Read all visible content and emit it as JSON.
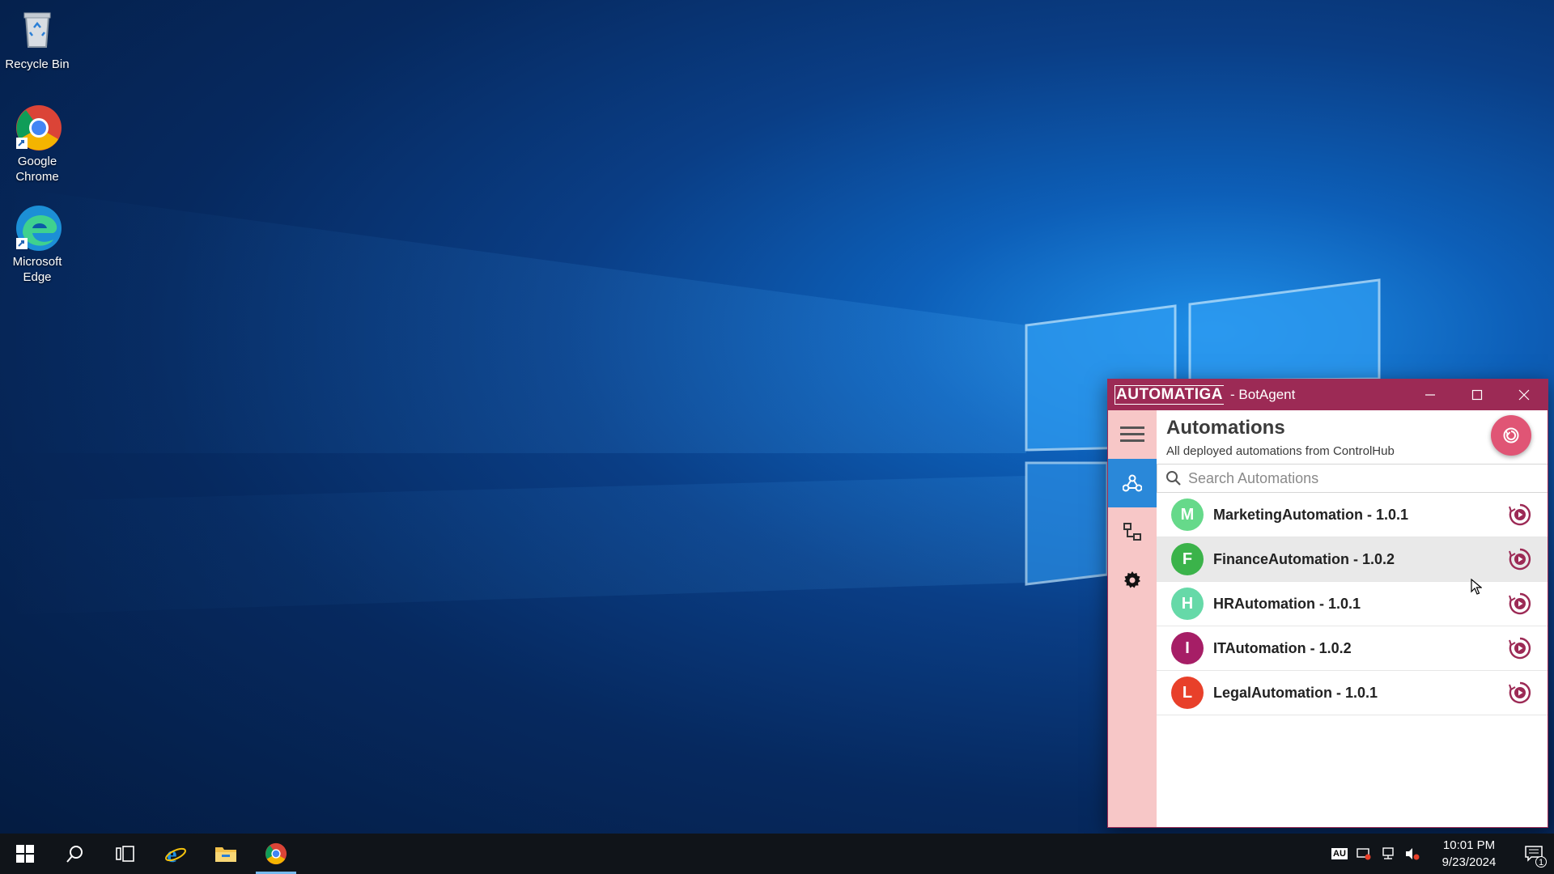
{
  "desktop": {
    "icons": [
      {
        "label_line1": "Recycle Bin",
        "label_line2": "",
        "icon": "recycle-bin-icon"
      },
      {
        "label_line1": "Google",
        "label_line2": "Chrome",
        "icon": "chrome-icon"
      },
      {
        "label_line1": "Microsoft",
        "label_line2": "Edge",
        "icon": "edge-icon"
      }
    ]
  },
  "window": {
    "brand": "AUTOMATIGA",
    "title": "- BotAgent",
    "accent": "#9c2a55"
  },
  "sidebar": {
    "items": [
      {
        "icon": "hamburger-menu-icon"
      },
      {
        "icon": "automations-icon",
        "active": true
      },
      {
        "icon": "robot-connections-icon"
      },
      {
        "icon": "settings-gear-icon"
      }
    ]
  },
  "page": {
    "title": "Automations",
    "subtitle": "All deployed automations from ControlHub",
    "search_placeholder": "Search Automations"
  },
  "automations": [
    {
      "initial": "M",
      "name": "MarketingAutomation - 1.0.1",
      "color": "#66d98a"
    },
    {
      "initial": "F",
      "name": "FinanceAutomation - 1.0.2",
      "color": "#3bb34a"
    },
    {
      "initial": "H",
      "name": "HRAutomation - 1.0.1",
      "color": "#66d9a8"
    },
    {
      "initial": "I",
      "name": "ITAutomation - 1.0.2",
      "color": "#a61e66"
    },
    {
      "initial": "L",
      "name": "LegalAutomation - 1.0.1",
      "color": "#e8402a"
    }
  ],
  "taskbar": {
    "tray_label": "AU",
    "time": "10:01 PM",
    "date": "9/23/2024",
    "notification_count": "1"
  }
}
